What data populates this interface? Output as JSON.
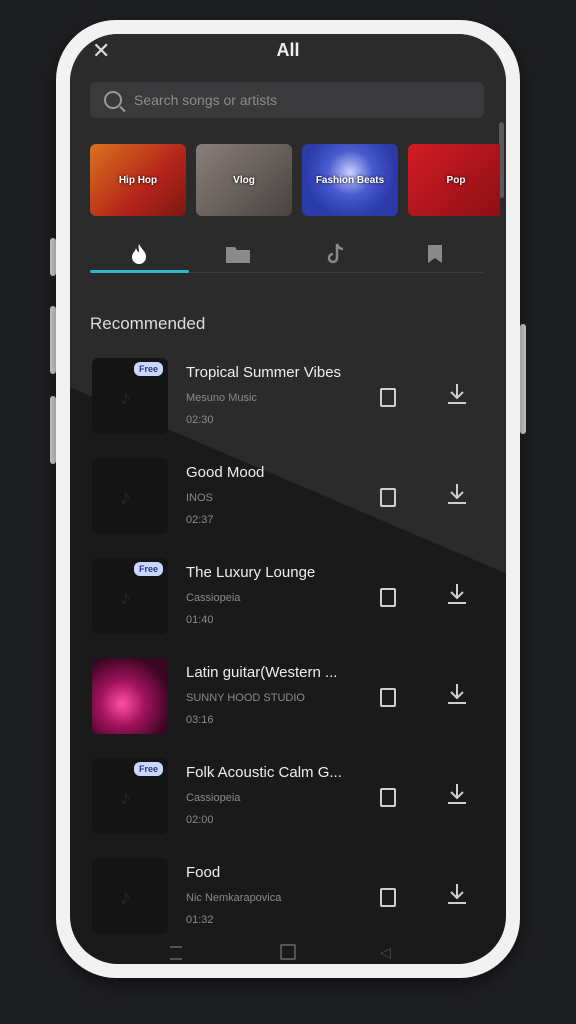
{
  "header": {
    "title": "All",
    "close_glyph": "✕"
  },
  "search": {
    "placeholder": "Search songs or artists"
  },
  "categories": [
    {
      "label": "Hip Hop",
      "color": "#b5231a"
    },
    {
      "label": "Vlog",
      "color": "#6a6260"
    },
    {
      "label": "Fashion Beats",
      "color": "#2a3aa8"
    },
    {
      "label": "Pop",
      "color": "#b8141c"
    }
  ],
  "tabs": [
    {
      "icon": "flame-icon",
      "glyph": "🔥",
      "active": true
    },
    {
      "icon": "folder-icon",
      "glyph": "▬",
      "active": false
    },
    {
      "icon": "tiktok-icon",
      "glyph": "♪",
      "active": false
    },
    {
      "icon": "bookmark-icon",
      "glyph": "▮",
      "active": false
    }
  ],
  "section": {
    "title": "Recommended"
  },
  "tracks": [
    {
      "name": "Tropical Summer Vibes",
      "artist": "Mesuno Music",
      "duration": "02:30",
      "free": true,
      "badge": "Free"
    },
    {
      "name": "Good Mood",
      "artist": "INOS",
      "duration": "02:37",
      "free": false,
      "badge": ""
    },
    {
      "name": "The Luxury Lounge",
      "artist": "Cassiopeia",
      "duration": "01:40",
      "free": true,
      "badge": "Free"
    },
    {
      "name": "Latin guitar(Western ...",
      "artist": "SUNNY HOOD STUDIO",
      "duration": "03:16",
      "free": false,
      "badge": ""
    },
    {
      "name": "Folk Acoustic Calm G...",
      "artist": "Cassiopeia",
      "duration": "02:00",
      "free": true,
      "badge": "Free"
    },
    {
      "name": "Food",
      "artist": "Nic Nemkarapovica",
      "duration": "01:32",
      "free": false,
      "badge": ""
    }
  ],
  "colors": {
    "accent": "#2fb7c7",
    "background": "#1a1a1a",
    "badge_bg": "#c9d7ff"
  }
}
